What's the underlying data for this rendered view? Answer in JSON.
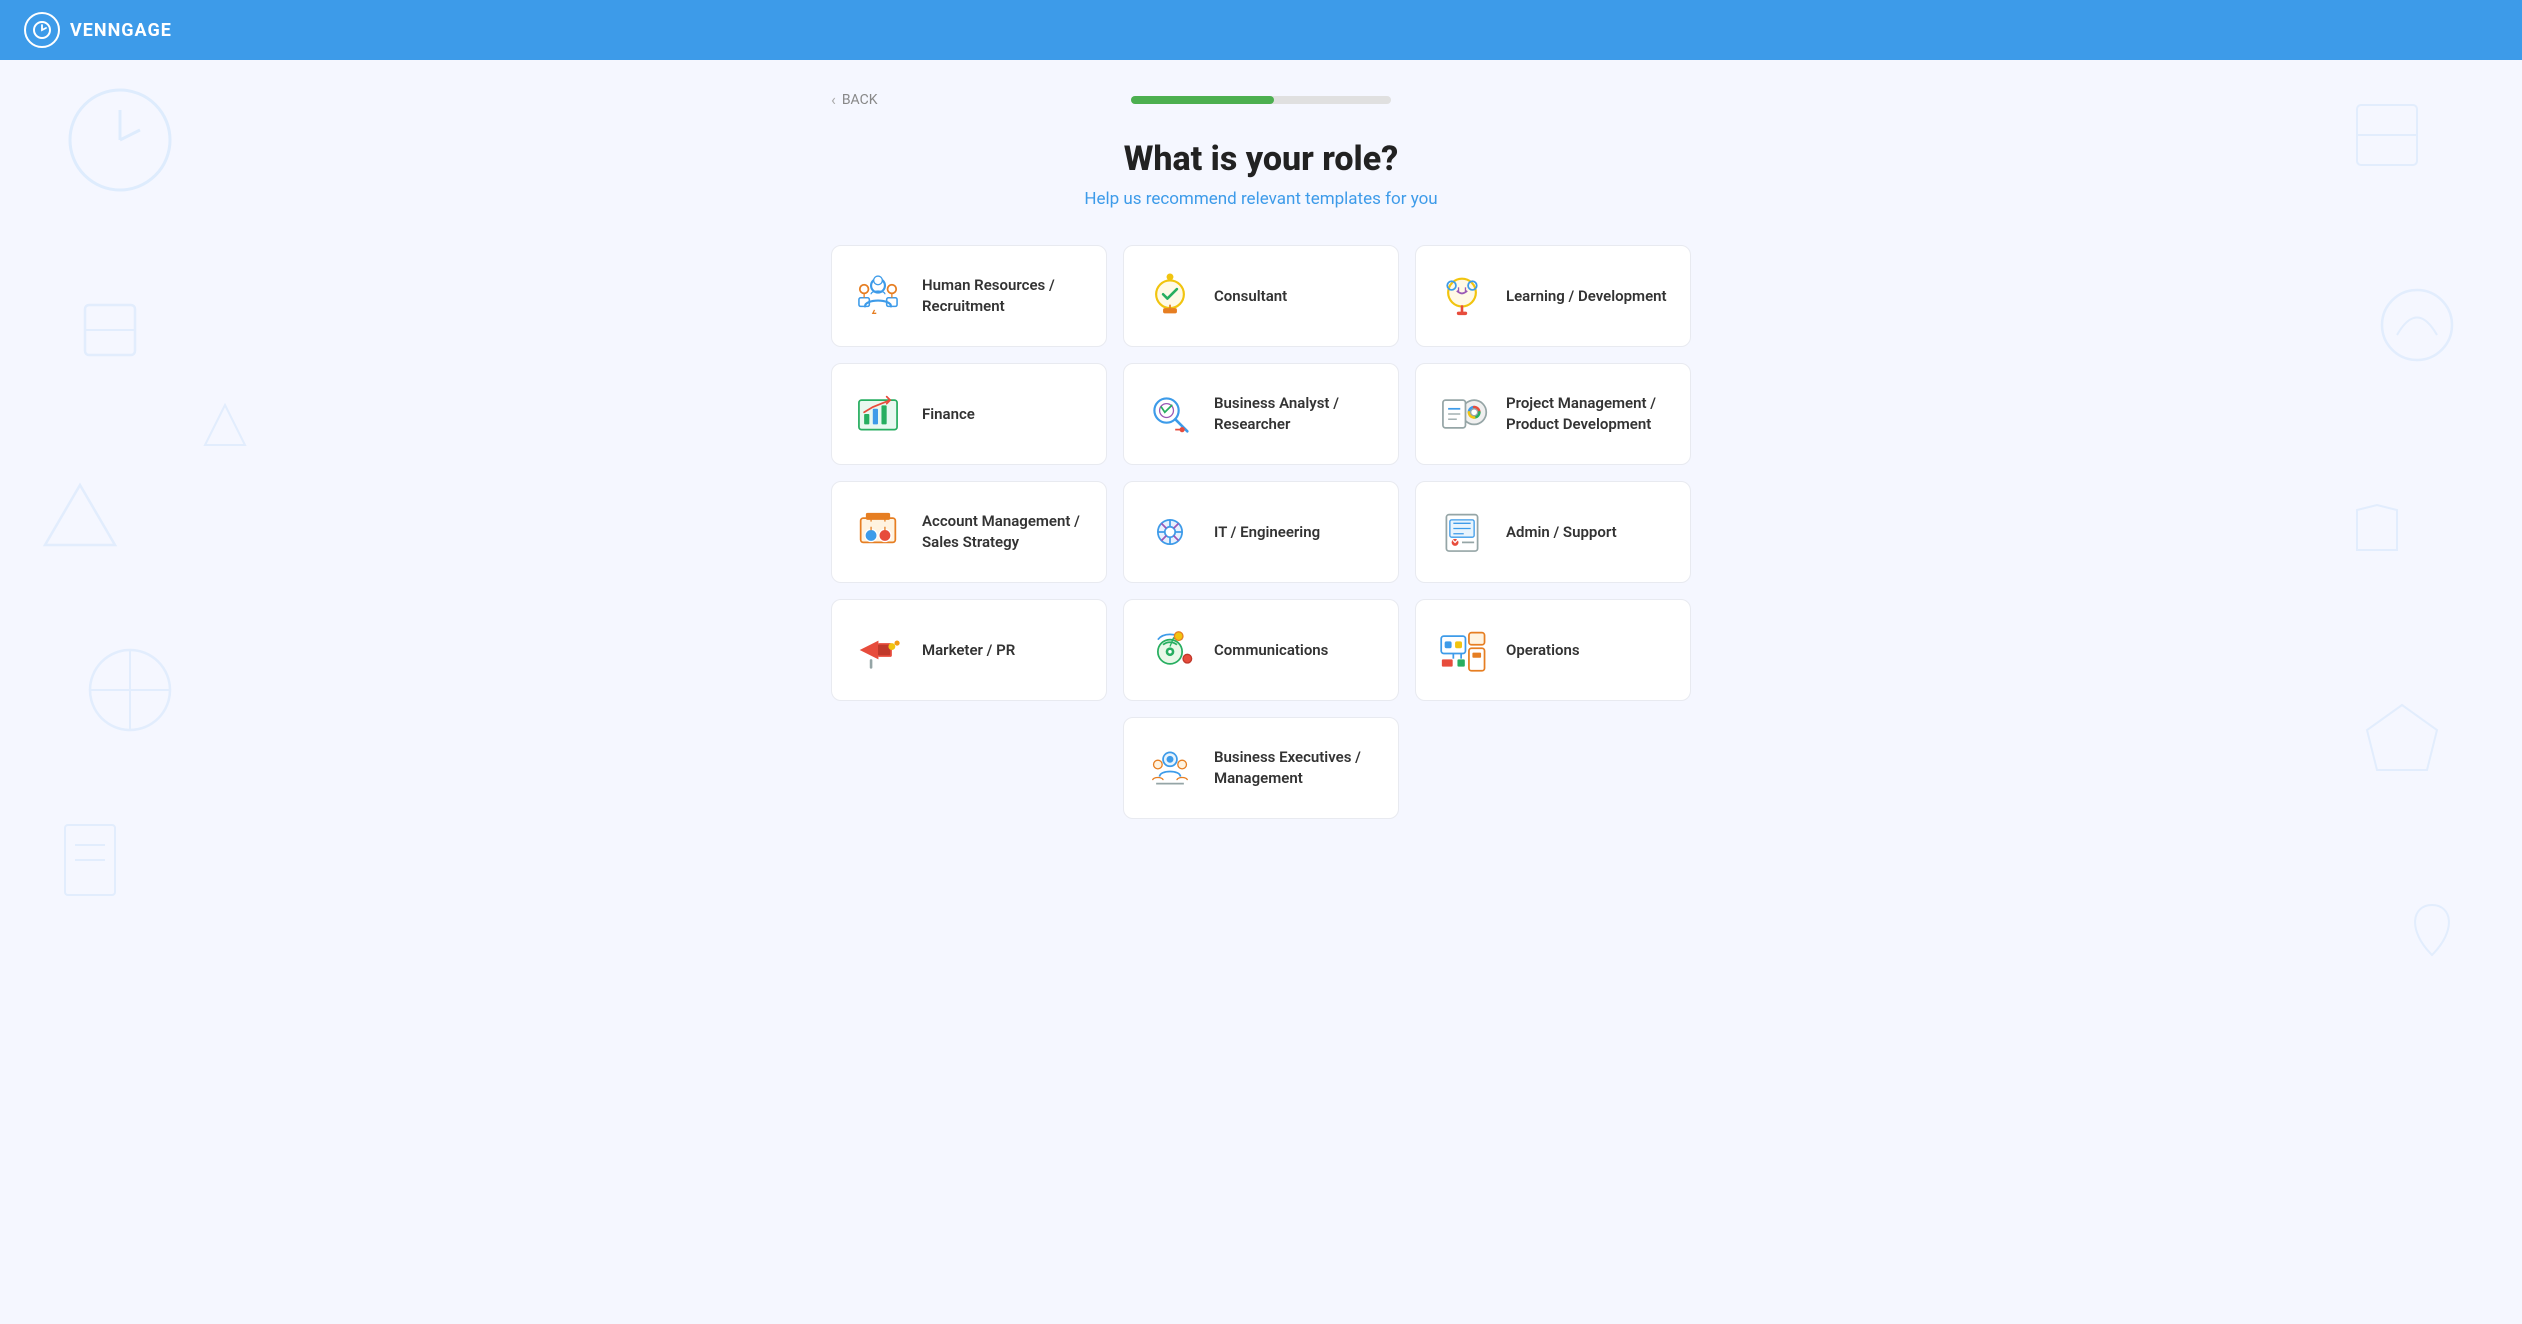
{
  "header": {
    "logo_text": "VENNGAGE",
    "logo_icon": "clock"
  },
  "nav": {
    "back_label": "BACK"
  },
  "progress": {
    "fill_percent": 55
  },
  "page": {
    "title": "What is your role?",
    "subtitle": "Help us recommend relevant templates for you"
  },
  "roles": [
    {
      "id": "human-resources",
      "label": "Human Resources /\nRecruitment",
      "icon": "hr"
    },
    {
      "id": "consultant",
      "label": "Consultant",
      "icon": "consultant"
    },
    {
      "id": "learning-development",
      "label": "Learning / Development",
      "icon": "learning"
    },
    {
      "id": "finance",
      "label": "Finance",
      "icon": "finance"
    },
    {
      "id": "business-analyst",
      "label": "Business Analyst /\nResearcher",
      "icon": "analyst"
    },
    {
      "id": "project-management",
      "label": "Project Management /\nProduct Development",
      "icon": "project"
    },
    {
      "id": "account-management",
      "label": "Account Management /\nSales Strategy",
      "icon": "account"
    },
    {
      "id": "it-engineering",
      "label": "IT / Engineering",
      "icon": "it"
    },
    {
      "id": "admin-support",
      "label": "Admin / Support",
      "icon": "admin"
    },
    {
      "id": "marketer-pr",
      "label": "Marketer / PR",
      "icon": "marketer"
    },
    {
      "id": "communications",
      "label": "Communications",
      "icon": "communications"
    },
    {
      "id": "operations",
      "label": "Operations",
      "icon": "operations"
    },
    {
      "id": "business-executives",
      "label": "Business Executives /\nManagement",
      "icon": "executives"
    }
  ]
}
